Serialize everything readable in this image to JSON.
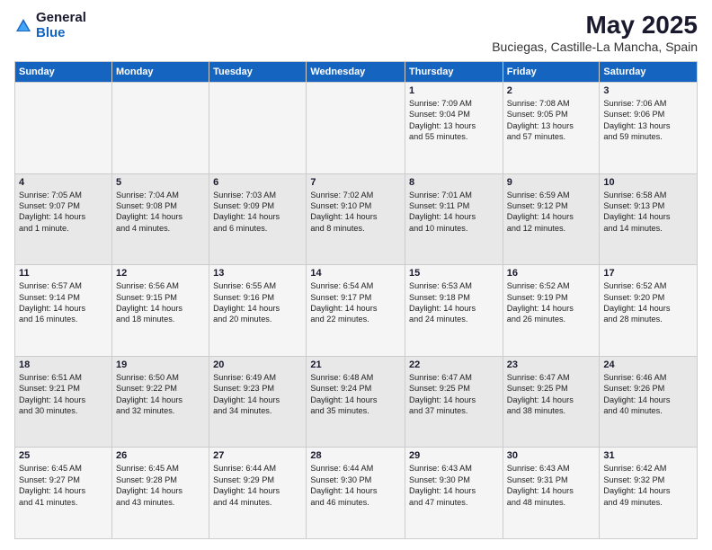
{
  "header": {
    "logo_general": "General",
    "logo_blue": "Blue",
    "month": "May 2025",
    "location": "Buciegas, Castille-La Mancha, Spain"
  },
  "weekdays": [
    "Sunday",
    "Monday",
    "Tuesday",
    "Wednesday",
    "Thursday",
    "Friday",
    "Saturday"
  ],
  "weeks": [
    [
      {
        "day": "",
        "info": ""
      },
      {
        "day": "",
        "info": ""
      },
      {
        "day": "",
        "info": ""
      },
      {
        "day": "",
        "info": ""
      },
      {
        "day": "1",
        "info": "Sunrise: 7:09 AM\nSunset: 9:04 PM\nDaylight: 13 hours\nand 55 minutes."
      },
      {
        "day": "2",
        "info": "Sunrise: 7:08 AM\nSunset: 9:05 PM\nDaylight: 13 hours\nand 57 minutes."
      },
      {
        "day": "3",
        "info": "Sunrise: 7:06 AM\nSunset: 9:06 PM\nDaylight: 13 hours\nand 59 minutes."
      }
    ],
    [
      {
        "day": "4",
        "info": "Sunrise: 7:05 AM\nSunset: 9:07 PM\nDaylight: 14 hours\nand 1 minute."
      },
      {
        "day": "5",
        "info": "Sunrise: 7:04 AM\nSunset: 9:08 PM\nDaylight: 14 hours\nand 4 minutes."
      },
      {
        "day": "6",
        "info": "Sunrise: 7:03 AM\nSunset: 9:09 PM\nDaylight: 14 hours\nand 6 minutes."
      },
      {
        "day": "7",
        "info": "Sunrise: 7:02 AM\nSunset: 9:10 PM\nDaylight: 14 hours\nand 8 minutes."
      },
      {
        "day": "8",
        "info": "Sunrise: 7:01 AM\nSunset: 9:11 PM\nDaylight: 14 hours\nand 10 minutes."
      },
      {
        "day": "9",
        "info": "Sunrise: 6:59 AM\nSunset: 9:12 PM\nDaylight: 14 hours\nand 12 minutes."
      },
      {
        "day": "10",
        "info": "Sunrise: 6:58 AM\nSunset: 9:13 PM\nDaylight: 14 hours\nand 14 minutes."
      }
    ],
    [
      {
        "day": "11",
        "info": "Sunrise: 6:57 AM\nSunset: 9:14 PM\nDaylight: 14 hours\nand 16 minutes."
      },
      {
        "day": "12",
        "info": "Sunrise: 6:56 AM\nSunset: 9:15 PM\nDaylight: 14 hours\nand 18 minutes."
      },
      {
        "day": "13",
        "info": "Sunrise: 6:55 AM\nSunset: 9:16 PM\nDaylight: 14 hours\nand 20 minutes."
      },
      {
        "day": "14",
        "info": "Sunrise: 6:54 AM\nSunset: 9:17 PM\nDaylight: 14 hours\nand 22 minutes."
      },
      {
        "day": "15",
        "info": "Sunrise: 6:53 AM\nSunset: 9:18 PM\nDaylight: 14 hours\nand 24 minutes."
      },
      {
        "day": "16",
        "info": "Sunrise: 6:52 AM\nSunset: 9:19 PM\nDaylight: 14 hours\nand 26 minutes."
      },
      {
        "day": "17",
        "info": "Sunrise: 6:52 AM\nSunset: 9:20 PM\nDaylight: 14 hours\nand 28 minutes."
      }
    ],
    [
      {
        "day": "18",
        "info": "Sunrise: 6:51 AM\nSunset: 9:21 PM\nDaylight: 14 hours\nand 30 minutes."
      },
      {
        "day": "19",
        "info": "Sunrise: 6:50 AM\nSunset: 9:22 PM\nDaylight: 14 hours\nand 32 minutes."
      },
      {
        "day": "20",
        "info": "Sunrise: 6:49 AM\nSunset: 9:23 PM\nDaylight: 14 hours\nand 34 minutes."
      },
      {
        "day": "21",
        "info": "Sunrise: 6:48 AM\nSunset: 9:24 PM\nDaylight: 14 hours\nand 35 minutes."
      },
      {
        "day": "22",
        "info": "Sunrise: 6:47 AM\nSunset: 9:25 PM\nDaylight: 14 hours\nand 37 minutes."
      },
      {
        "day": "23",
        "info": "Sunrise: 6:47 AM\nSunset: 9:25 PM\nDaylight: 14 hours\nand 38 minutes."
      },
      {
        "day": "24",
        "info": "Sunrise: 6:46 AM\nSunset: 9:26 PM\nDaylight: 14 hours\nand 40 minutes."
      }
    ],
    [
      {
        "day": "25",
        "info": "Sunrise: 6:45 AM\nSunset: 9:27 PM\nDaylight: 14 hours\nand 41 minutes."
      },
      {
        "day": "26",
        "info": "Sunrise: 6:45 AM\nSunset: 9:28 PM\nDaylight: 14 hours\nand 43 minutes."
      },
      {
        "day": "27",
        "info": "Sunrise: 6:44 AM\nSunset: 9:29 PM\nDaylight: 14 hours\nand 44 minutes."
      },
      {
        "day": "28",
        "info": "Sunrise: 6:44 AM\nSunset: 9:30 PM\nDaylight: 14 hours\nand 46 minutes."
      },
      {
        "day": "29",
        "info": "Sunrise: 6:43 AM\nSunset: 9:30 PM\nDaylight: 14 hours\nand 47 minutes."
      },
      {
        "day": "30",
        "info": "Sunrise: 6:43 AM\nSunset: 9:31 PM\nDaylight: 14 hours\nand 48 minutes."
      },
      {
        "day": "31",
        "info": "Sunrise: 6:42 AM\nSunset: 9:32 PM\nDaylight: 14 hours\nand 49 minutes."
      }
    ]
  ]
}
